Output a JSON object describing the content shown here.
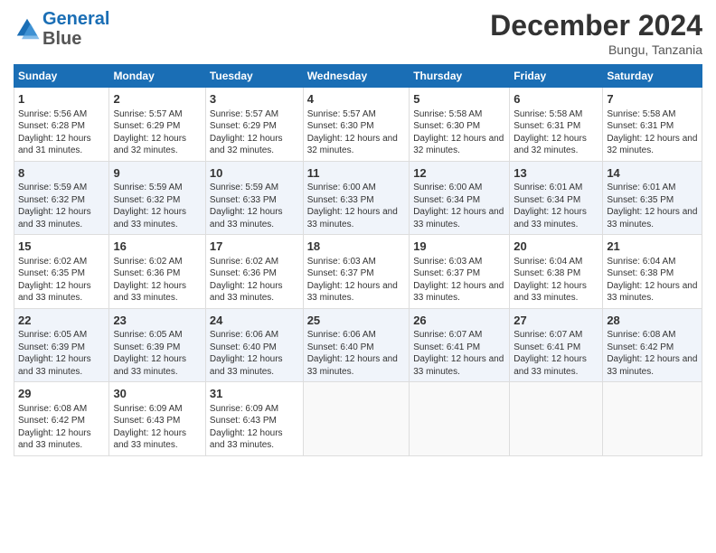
{
  "logo": {
    "line1": "General",
    "line2": "Blue"
  },
  "title": "December 2024",
  "location": "Bungu, Tanzania",
  "days_of_week": [
    "Sunday",
    "Monday",
    "Tuesday",
    "Wednesday",
    "Thursday",
    "Friday",
    "Saturday"
  ],
  "weeks": [
    [
      {
        "day": 1,
        "sunrise": "5:56 AM",
        "sunset": "6:28 PM",
        "daylight": "12 hours and 31 minutes."
      },
      {
        "day": 2,
        "sunrise": "5:57 AM",
        "sunset": "6:29 PM",
        "daylight": "12 hours and 32 minutes."
      },
      {
        "day": 3,
        "sunrise": "5:57 AM",
        "sunset": "6:29 PM",
        "daylight": "12 hours and 32 minutes."
      },
      {
        "day": 4,
        "sunrise": "5:57 AM",
        "sunset": "6:30 PM",
        "daylight": "12 hours and 32 minutes."
      },
      {
        "day": 5,
        "sunrise": "5:58 AM",
        "sunset": "6:30 PM",
        "daylight": "12 hours and 32 minutes."
      },
      {
        "day": 6,
        "sunrise": "5:58 AM",
        "sunset": "6:31 PM",
        "daylight": "12 hours and 32 minutes."
      },
      {
        "day": 7,
        "sunrise": "5:58 AM",
        "sunset": "6:31 PM",
        "daylight": "12 hours and 32 minutes."
      }
    ],
    [
      {
        "day": 8,
        "sunrise": "5:59 AM",
        "sunset": "6:32 PM",
        "daylight": "12 hours and 33 minutes."
      },
      {
        "day": 9,
        "sunrise": "5:59 AM",
        "sunset": "6:32 PM",
        "daylight": "12 hours and 33 minutes."
      },
      {
        "day": 10,
        "sunrise": "5:59 AM",
        "sunset": "6:33 PM",
        "daylight": "12 hours and 33 minutes."
      },
      {
        "day": 11,
        "sunrise": "6:00 AM",
        "sunset": "6:33 PM",
        "daylight": "12 hours and 33 minutes."
      },
      {
        "day": 12,
        "sunrise": "6:00 AM",
        "sunset": "6:34 PM",
        "daylight": "12 hours and 33 minutes."
      },
      {
        "day": 13,
        "sunrise": "6:01 AM",
        "sunset": "6:34 PM",
        "daylight": "12 hours and 33 minutes."
      },
      {
        "day": 14,
        "sunrise": "6:01 AM",
        "sunset": "6:35 PM",
        "daylight": "12 hours and 33 minutes."
      }
    ],
    [
      {
        "day": 15,
        "sunrise": "6:02 AM",
        "sunset": "6:35 PM",
        "daylight": "12 hours and 33 minutes."
      },
      {
        "day": 16,
        "sunrise": "6:02 AM",
        "sunset": "6:36 PM",
        "daylight": "12 hours and 33 minutes."
      },
      {
        "day": 17,
        "sunrise": "6:02 AM",
        "sunset": "6:36 PM",
        "daylight": "12 hours and 33 minutes."
      },
      {
        "day": 18,
        "sunrise": "6:03 AM",
        "sunset": "6:37 PM",
        "daylight": "12 hours and 33 minutes."
      },
      {
        "day": 19,
        "sunrise": "6:03 AM",
        "sunset": "6:37 PM",
        "daylight": "12 hours and 33 minutes."
      },
      {
        "day": 20,
        "sunrise": "6:04 AM",
        "sunset": "6:38 PM",
        "daylight": "12 hours and 33 minutes."
      },
      {
        "day": 21,
        "sunrise": "6:04 AM",
        "sunset": "6:38 PM",
        "daylight": "12 hours and 33 minutes."
      }
    ],
    [
      {
        "day": 22,
        "sunrise": "6:05 AM",
        "sunset": "6:39 PM",
        "daylight": "12 hours and 33 minutes."
      },
      {
        "day": 23,
        "sunrise": "6:05 AM",
        "sunset": "6:39 PM",
        "daylight": "12 hours and 33 minutes."
      },
      {
        "day": 24,
        "sunrise": "6:06 AM",
        "sunset": "6:40 PM",
        "daylight": "12 hours and 33 minutes."
      },
      {
        "day": 25,
        "sunrise": "6:06 AM",
        "sunset": "6:40 PM",
        "daylight": "12 hours and 33 minutes."
      },
      {
        "day": 26,
        "sunrise": "6:07 AM",
        "sunset": "6:41 PM",
        "daylight": "12 hours and 33 minutes."
      },
      {
        "day": 27,
        "sunrise": "6:07 AM",
        "sunset": "6:41 PM",
        "daylight": "12 hours and 33 minutes."
      },
      {
        "day": 28,
        "sunrise": "6:08 AM",
        "sunset": "6:42 PM",
        "daylight": "12 hours and 33 minutes."
      }
    ],
    [
      {
        "day": 29,
        "sunrise": "6:08 AM",
        "sunset": "6:42 PM",
        "daylight": "12 hours and 33 minutes."
      },
      {
        "day": 30,
        "sunrise": "6:09 AM",
        "sunset": "6:43 PM",
        "daylight": "12 hours and 33 minutes."
      },
      {
        "day": 31,
        "sunrise": "6:09 AM",
        "sunset": "6:43 PM",
        "daylight": "12 hours and 33 minutes."
      },
      null,
      null,
      null,
      null
    ]
  ]
}
